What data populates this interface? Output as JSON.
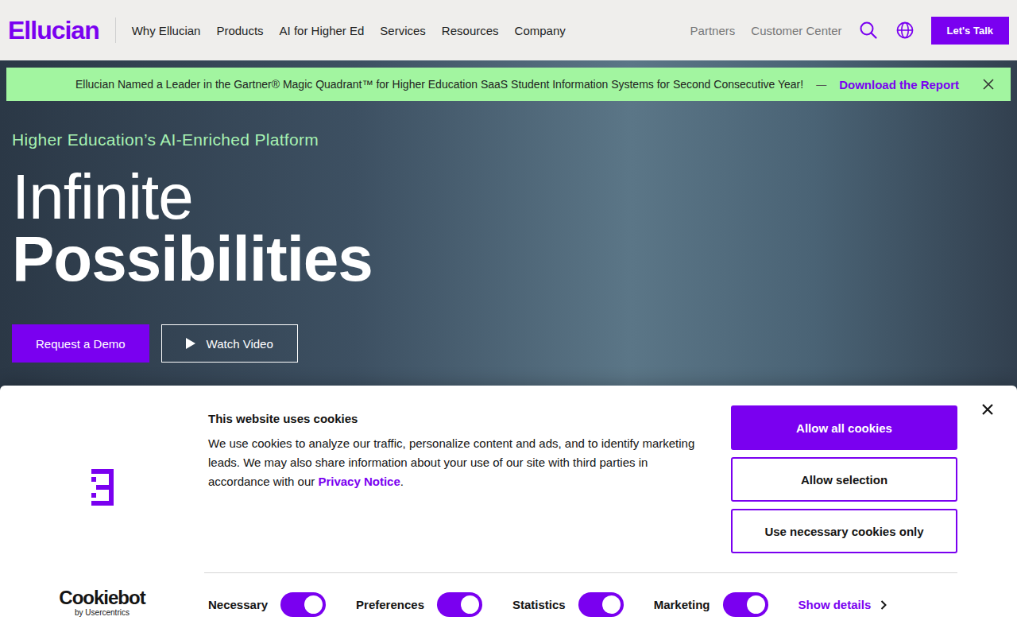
{
  "header": {
    "logo": "Ellucian",
    "nav": [
      "Why Ellucian",
      "Products",
      "AI for Higher Ed",
      "Services",
      "Resources",
      "Company"
    ],
    "utility": [
      "Partners",
      "Customer Center"
    ],
    "cta": "Let's Talk"
  },
  "announcement": {
    "text": "Ellucian Named a Leader in the Gartner® Magic Quadrant™ for Higher Education SaaS Student Information Systems for Second Consecutive Year!",
    "separator": "—",
    "link": "Download the Report"
  },
  "hero": {
    "eyebrow": "Higher Education’s AI-Enriched Platform",
    "title_light": "Infinite",
    "title_bold": "Possibilities",
    "buttons": [
      {
        "label": "Request a Demo",
        "kind": "primary"
      },
      {
        "label": "Watch Video",
        "kind": "video"
      }
    ]
  },
  "cookie_banner": {
    "title": "This website uses cookies",
    "body": "We use cookies to analyze our traffic, personalize content and ads, and to identify marketing leads. We may also share information about your use of our site with third parties in accordance with our ",
    "link": "Privacy Notice",
    "body_end": ".",
    "buttons": [
      {
        "label": "Allow all cookies",
        "kind": "primary"
      },
      {
        "label": "Allow selection",
        "kind": "outline"
      },
      {
        "label": "Use necessary cookies only",
        "kind": "outline"
      }
    ],
    "categories": [
      {
        "label": "Necessary",
        "on": true
      },
      {
        "label": "Preferences",
        "on": true
      },
      {
        "label": "Statistics",
        "on": true
      },
      {
        "label": "Marketing",
        "on": true
      }
    ],
    "details_link": "Show details",
    "brand": {
      "name": "Cookiebot",
      "by": "by Usercentrics"
    }
  }
}
